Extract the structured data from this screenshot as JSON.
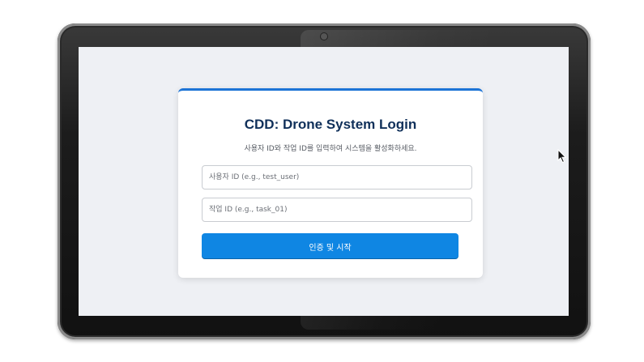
{
  "login": {
    "title": "CDD: Drone System Login",
    "subtitle": "사용자 ID와 작업 ID를 입력하여 시스템을 활성화하세요.",
    "user_id_placeholder": "사용자 ID (e.g., test_user)",
    "task_id_placeholder": "작업 ID (e.g., task_01)",
    "submit_label": "인증 및 시작",
    "user_id_value": "",
    "task_id_value": ""
  },
  "colors": {
    "accent": "#1d74d6",
    "button": "#0f86e3",
    "title": "#10305a",
    "screen_bg": "#eef0f4"
  },
  "icons": {
    "pointer": "mouse-pointer-icon"
  }
}
